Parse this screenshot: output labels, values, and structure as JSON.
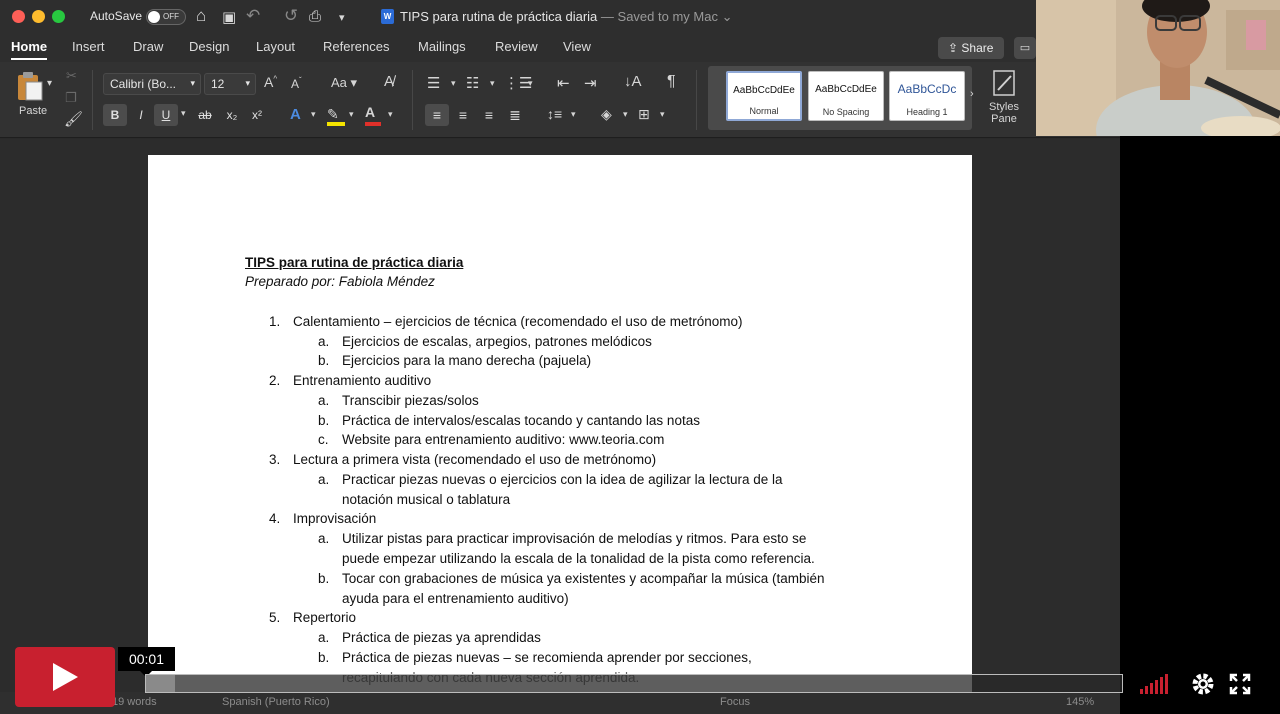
{
  "titlebar": {
    "autosave_label": "AutoSave",
    "autosave_state": "OFF",
    "document_title": "TIPS para rutina de práctica diaria",
    "saved_status": "— Saved to my Mac"
  },
  "ribbon_tabs": [
    "Home",
    "Insert",
    "Draw",
    "Design",
    "Layout",
    "References",
    "Mailings",
    "Review",
    "View"
  ],
  "active_tab": "Home",
  "share_label": "Share",
  "clipboard": {
    "paste_label": "Paste"
  },
  "font": {
    "family": "Calibri (Bo...",
    "size": "12"
  },
  "format_buttons": {
    "bold": "B",
    "italic": "I",
    "underline": "U",
    "strike": "ab",
    "sub": "x₂",
    "sup": "x²"
  },
  "styles": [
    {
      "sample": "AaBbCcDdEe",
      "label": "Normal"
    },
    {
      "sample": "AaBbCcDdEe",
      "label": "No Spacing"
    },
    {
      "sample": "AaBbCcDc",
      "label": "Heading 1"
    }
  ],
  "styles_pane_label": "Styles Pane",
  "document": {
    "heading": "TIPS para rutina de práctica diaria",
    "author": "Preparado por: Fabiola Méndez",
    "items": [
      {
        "num": "1.",
        "text": "Calentamiento – ejercicios de técnica (recomendado el uso de metrónomo)",
        "sub": [
          {
            "letter": "a.",
            "lines": [
              "Ejercicios de escalas, arpegios, patrones melódicos"
            ]
          },
          {
            "letter": "b.",
            "lines": [
              "Ejercicios para la mano derecha (pajuela)"
            ]
          }
        ]
      },
      {
        "num": "2.",
        "text": "Entrenamiento auditivo",
        "sub": [
          {
            "letter": "a.",
            "lines": [
              "Transcibir piezas/solos"
            ]
          },
          {
            "letter": "b.",
            "lines": [
              "Práctica de intervalos/escalas tocando y cantando las notas"
            ]
          },
          {
            "letter": "c.",
            "lines": [
              "Website para entrenamiento auditivo: www.teoria.com"
            ]
          }
        ]
      },
      {
        "num": "3.",
        "text": "Lectura a primera vista (recomendado el uso de metrónomo)",
        "sub": [
          {
            "letter": "a.",
            "lines": [
              "Practicar piezas nuevas o ejercicios con la idea de agilizar la lectura de la",
              "notación musical o tablatura"
            ]
          }
        ]
      },
      {
        "num": "4.",
        "text": "Improvisación",
        "sub": [
          {
            "letter": "a.",
            "lines": [
              "Utilizar pistas para practicar improvisación de melodías y ritmos. Para esto se",
              "puede empezar utilizando la escala de la tonalidad de la pista como referencia."
            ]
          },
          {
            "letter": "b.",
            "lines": [
              "Tocar con grabaciones de música ya existentes y acompañar la música (también",
              "ayuda para el entrenamiento auditivo)"
            ]
          }
        ]
      },
      {
        "num": "5.",
        "text": "Repertorio",
        "sub": [
          {
            "letter": "a.",
            "lines": [
              "Práctica de piezas ya aprendidas"
            ]
          },
          {
            "letter": "b.",
            "lines": [
              "Práctica de piezas nuevas – se recomienda aprender por secciones,",
              "recapitulando con cada nueva sección aprendida."
            ]
          }
        ]
      }
    ]
  },
  "statusbar": {
    "words": "19 words",
    "language": "Spanish (Puerto Rico)",
    "focus": "Focus",
    "zoom": "145%"
  },
  "player": {
    "time": "00:01",
    "progress_fraction": 0.03,
    "accent": "#c8202f"
  }
}
